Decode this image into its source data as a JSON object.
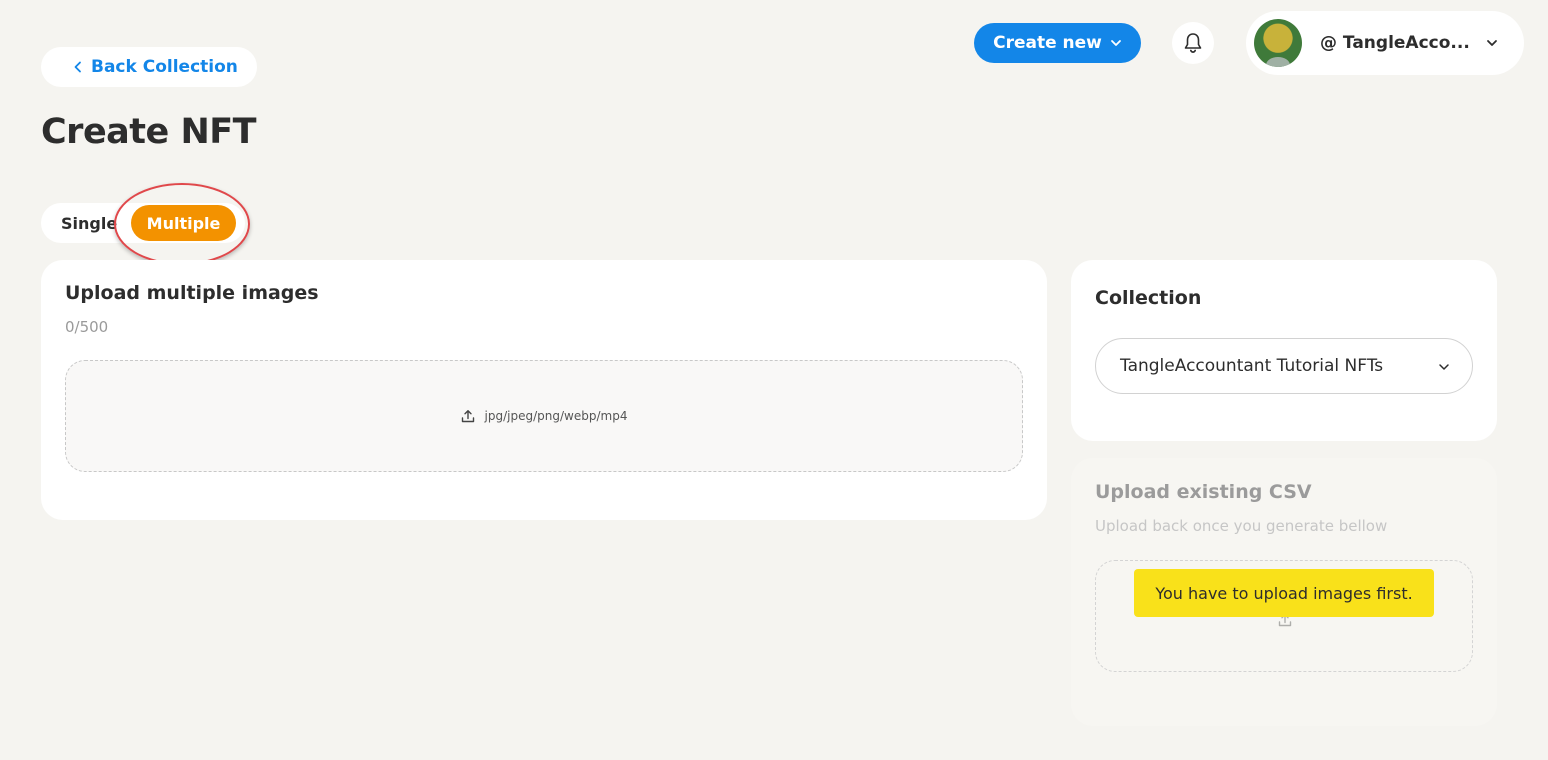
{
  "header": {
    "create_new_label": "Create new",
    "profile_name": "@ TangleAcco..."
  },
  "nav": {
    "back_label": "Back Collection"
  },
  "page": {
    "title": "Create NFT"
  },
  "mode_toggle": {
    "single_label": "Single",
    "multiple_label": "Multiple",
    "selected": "Multiple"
  },
  "upload_images": {
    "title": "Upload multiple images",
    "counter": "0/500",
    "formats": "jpg/jpeg/png/webp/mp4"
  },
  "collection": {
    "title": "Collection",
    "selected_value": "TangleAccountant Tutorial NFTs"
  },
  "csv_upload": {
    "title": "Upload existing CSV",
    "subtitle": "Upload back once you generate bellow",
    "tooltip": "You have to upload images first."
  },
  "colors": {
    "background": "#f5f4f0",
    "primary_blue": "#1386e8",
    "accent_orange": "#f39200",
    "tooltip_yellow": "#f9e11a",
    "highlight_red": "#e0484b"
  },
  "icons": [
    "chevron-down-icon",
    "bell-icon",
    "chevron-left-icon",
    "upload-icon"
  ]
}
